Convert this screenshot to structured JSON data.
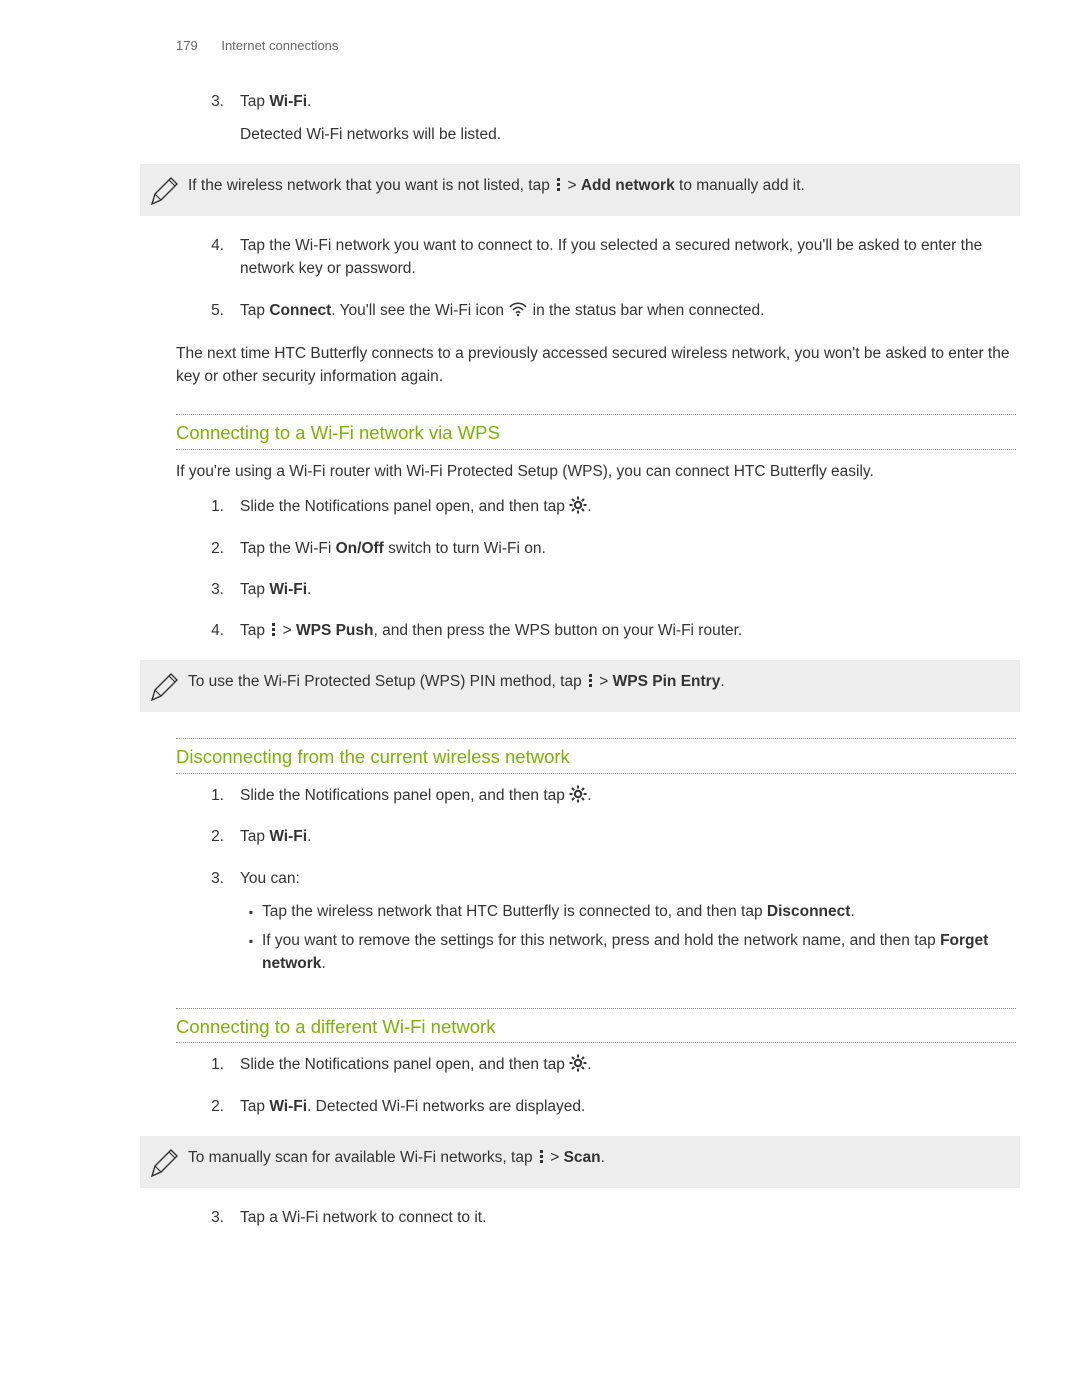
{
  "header": {
    "page_number": "179",
    "section": "Internet connections"
  },
  "intro_steps": {
    "s3": {
      "num": "3.",
      "text_prefix": "Tap ",
      "text_bold": "Wi-Fi",
      "text_suffix": ".",
      "followup": "Detected Wi-Fi networks will be listed."
    }
  },
  "note1": {
    "pre": "If the wireless network that you want is not listed, tap ",
    "post_gt": " > ",
    "bold": "Add network",
    "after": " to manually add it."
  },
  "intro_steps2": {
    "s4": {
      "num": "4.",
      "text": "Tap the Wi-Fi network you want to connect to. If you selected a secured network, you'll be asked to enter the network key or password."
    },
    "s5": {
      "num": "5.",
      "pre": "Tap ",
      "bold": "Connect",
      "mid": ". You'll see the Wi-Fi icon ",
      "after": " in the status bar when connected."
    }
  },
  "para_after": "The next time HTC Butterfly connects to a previously accessed secured wireless network, you won't be asked to enter the key or other security information again.",
  "sec_wps": {
    "title": "Connecting to a Wi-Fi network via WPS",
    "intro": "If you're using a Wi-Fi router with Wi-Fi Protected Setup (WPS), you can connect HTC Butterfly easily.",
    "s1": {
      "num": "1.",
      "pre": "Slide the Notifications panel open, and then tap ",
      "suffix": "."
    },
    "s2": {
      "num": "2.",
      "pre": "Tap the Wi-Fi ",
      "bold": "On/Off",
      "after": " switch to turn Wi-Fi on."
    },
    "s3": {
      "num": "3.",
      "pre": "Tap ",
      "bold": "Wi-Fi",
      "after": "."
    },
    "s4": {
      "num": "4.",
      "pre": "Tap ",
      "gt": " > ",
      "bold": "WPS Push",
      "after": ", and then press the WPS button on your Wi-Fi router."
    }
  },
  "note2": {
    "pre": "To use the Wi-Fi Protected Setup (WPS) PIN method, tap ",
    "gt": " > ",
    "bold": "WPS Pin Entry",
    "after": "."
  },
  "sec_disc": {
    "title": "Disconnecting from the current wireless network",
    "s1": {
      "num": "1.",
      "pre": "Slide the Notifications panel open, and then tap ",
      "suffix": "."
    },
    "s2": {
      "num": "2.",
      "pre": "Tap ",
      "bold": "Wi-Fi",
      "after": "."
    },
    "s3": {
      "num": "3.",
      "text": "You can:"
    },
    "b1": {
      "pre": "Tap the wireless network that HTC Butterfly is connected to, and then tap ",
      "bold": "Disconnect",
      "after": "."
    },
    "b2": {
      "pre": "If you want to remove the settings for this network, press and hold the network name, and then tap ",
      "bold": "Forget network",
      "after": "."
    }
  },
  "sec_diff": {
    "title": "Connecting to a different Wi-Fi network",
    "s1": {
      "num": "1.",
      "pre": "Slide the Notifications panel open, and then tap ",
      "suffix": "."
    },
    "s2": {
      "num": "2.",
      "pre": "Tap ",
      "bold": "Wi-Fi",
      "after": ". Detected Wi-Fi networks are displayed."
    },
    "s3": {
      "num": "3.",
      "text": "Tap a Wi-Fi network to connect to it."
    }
  },
  "note3": {
    "pre": "To manually scan for available Wi-Fi networks, tap ",
    "gt": " > ",
    "bold": "Scan",
    "after": "."
  }
}
